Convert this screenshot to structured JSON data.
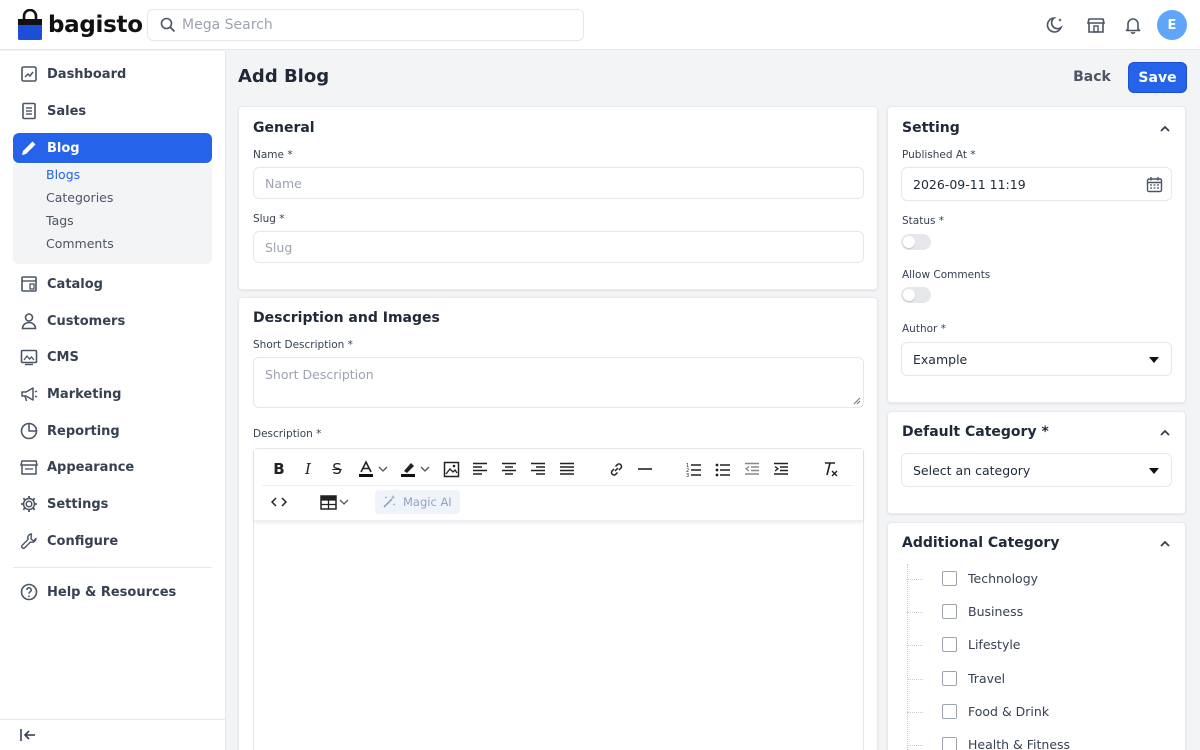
{
  "header": {
    "brand": "bagisto",
    "search_placeholder": "Mega Search",
    "avatar_initial": "E"
  },
  "sidebar": {
    "items": [
      {
        "label": "Dashboard",
        "icon": "dashboard-icon"
      },
      {
        "label": "Sales",
        "icon": "sales-icon"
      },
      {
        "label": "Blog",
        "icon": "pencil-icon",
        "active": true
      },
      {
        "label": "Catalog",
        "icon": "catalog-icon"
      },
      {
        "label": "Customers",
        "icon": "person-icon"
      },
      {
        "label": "CMS",
        "icon": "cms-icon"
      },
      {
        "label": "Marketing",
        "icon": "megaphone-icon"
      },
      {
        "label": "Reporting",
        "icon": "pie-chart-icon"
      },
      {
        "label": "Appearance",
        "icon": "store-icon"
      },
      {
        "label": "Settings",
        "icon": "gear-icon"
      },
      {
        "label": "Configure",
        "icon": "wrench-icon"
      }
    ],
    "blog_subitems": [
      "Blogs",
      "Categories",
      "Tags",
      "Comments"
    ],
    "help": "Help & Resources"
  },
  "page": {
    "title": "Add Blog",
    "back_label": "Back",
    "save_label": "Save"
  },
  "general": {
    "title": "General",
    "name_label": "Name *",
    "name_placeholder": "Name",
    "slug_label": "Slug *",
    "slug_placeholder": "Slug"
  },
  "description": {
    "title": "Description and Images",
    "short_label": "Short Description *",
    "short_placeholder": "Short Description",
    "desc_label": "Description *",
    "magic_ai": "Magic AI"
  },
  "setting": {
    "title": "Setting",
    "published_label": "Published At *",
    "published_value": "2026-09-11 11:19",
    "status_label": "Status *",
    "comments_label": "Allow Comments",
    "author_label": "Author *",
    "author_value": "Example"
  },
  "default_category": {
    "title": "Default Category *",
    "placeholder": "Select an category"
  },
  "additional_category": {
    "title": "Additional Category",
    "items": [
      "Technology",
      "Business",
      "Lifestyle",
      "Travel",
      "Food & Drink",
      "Health & Fitness"
    ]
  },
  "colors": {
    "primary": "#2563eb",
    "avatar": "#60a5fa"
  }
}
